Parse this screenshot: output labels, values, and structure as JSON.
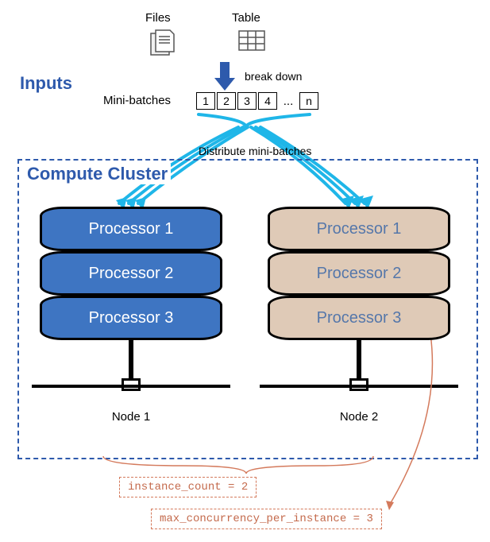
{
  "labels": {
    "inputs": "Inputs",
    "files": "Files",
    "table": "Table",
    "break_down": "break down",
    "mini_batches": "Mini-batches",
    "distribute": "Distribute mini-batches",
    "cluster": "Compute Cluster",
    "node1": "Node 1",
    "node2": "Node 2"
  },
  "batches": [
    "1",
    "2",
    "3",
    "4"
  ],
  "batch_ellipsis": "...",
  "batch_last": "n",
  "processors": {
    "node1": [
      "Processor 1",
      "Processor 2",
      "Processor 3"
    ],
    "node2": [
      "Processor 1",
      "Processor 2",
      "Processor 3"
    ]
  },
  "params": {
    "instance_count": "instance_count = 2",
    "max_concurrency": "max_concurrency_per_instance = 3"
  }
}
